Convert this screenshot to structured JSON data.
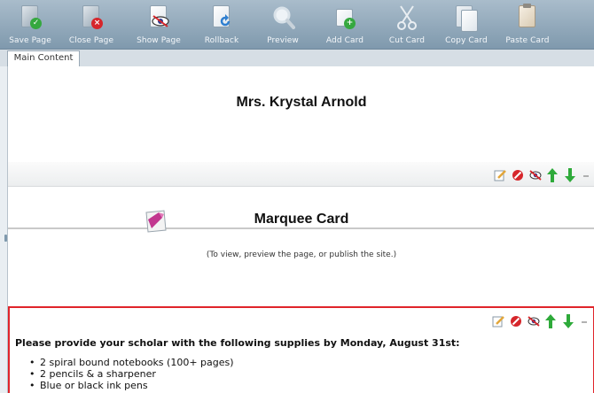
{
  "toolbar": {
    "items": [
      {
        "label": "Save Page"
      },
      {
        "label": "Close Page"
      },
      {
        "label": "Show Page"
      },
      {
        "label": "Rollback"
      },
      {
        "label": "Preview"
      },
      {
        "label": "Add Card"
      },
      {
        "label": "Cut Card"
      },
      {
        "label": "Copy Card"
      },
      {
        "label": "Paste Card"
      }
    ]
  },
  "tabs": [
    {
      "label": "Main Content"
    }
  ],
  "cards": {
    "header": {
      "title": "Mrs. Krystal Arnold"
    },
    "marquee": {
      "title": "Marquee Card",
      "note": "(To view, preview the page, or publish the site.)"
    },
    "supplies": {
      "heading": "Please provide your scholar with the following supplies by Monday, August 31st:",
      "items": [
        "2 spiral bound notebooks (100+ pages)",
        "2 pencils & a sharpener",
        "Blue or black ink pens"
      ]
    }
  },
  "colors": {
    "toolbar": "#8fa7b9",
    "selected_border": "#e0242a",
    "move_arrow": "#2eaa3a",
    "delete": "#d6262b"
  },
  "icons": {
    "save": "save-page-icon",
    "close": "close-page-icon",
    "show": "show-page-icon",
    "rollback": "rollback-icon",
    "preview": "preview-icon",
    "add": "add-card-icon",
    "cut": "cut-card-icon",
    "copy": "copy-card-icon",
    "paste": "paste-card-icon"
  }
}
